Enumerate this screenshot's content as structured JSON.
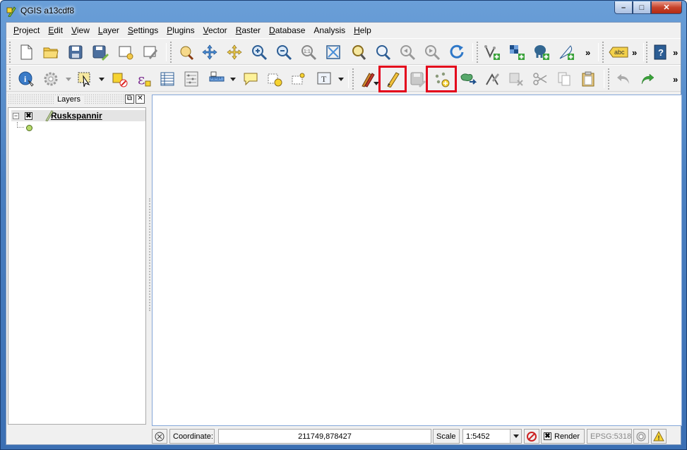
{
  "window": {
    "title": "QGIS a13cdf8",
    "controls": {
      "minimize": "–",
      "maximize": "□",
      "close": "✕"
    }
  },
  "menubar": {
    "items": [
      {
        "label": "Project",
        "mnemonic": "P",
        "rest": "roject"
      },
      {
        "label": "Edit",
        "mnemonic": "E",
        "rest": "dit"
      },
      {
        "label": "View",
        "mnemonic": "V",
        "rest": "iew"
      },
      {
        "label": "Layer",
        "mnemonic": "L",
        "rest": "ayer"
      },
      {
        "label": "Settings",
        "mnemonic": "S",
        "rest": "ettings"
      },
      {
        "label": "Plugins",
        "mnemonic": "P",
        "rest": "lugins"
      },
      {
        "label": "Vector",
        "mnemonic": "V",
        "rest": "ector"
      },
      {
        "label": "Raster",
        "mnemonic": "R",
        "rest": "aster"
      },
      {
        "label": "Database",
        "mnemonic": "D",
        "rest": "atabase"
      },
      {
        "label": "Analysis",
        "mnemonic": "",
        "rest": "Analysis"
      },
      {
        "label": "Help",
        "mnemonic": "H",
        "rest": "elp"
      }
    ]
  },
  "toolbar1": {
    "overflow": "»",
    "label_tool_text": "abc",
    "help_text": "?"
  },
  "toolbar2": {
    "overflow": "»",
    "text_annotation": "T",
    "expression_symbol": "ε"
  },
  "highlights": [
    "toggle-editing-button",
    "add-feature-button"
  ],
  "layers_panel": {
    "title": "Layers",
    "float_btn": "⧉",
    "close_btn": "✕",
    "tree": [
      {
        "name": "Ruskspannir",
        "expanded": true,
        "checked": true,
        "checkmark": "✖",
        "expander": "−",
        "symbol": "point"
      }
    ]
  },
  "statusbar": {
    "coordinate_label": "Coordinate:",
    "coordinate_value": "211749,878427",
    "scale_label": "Scale",
    "scale_value": "1:5452",
    "render_checkmark": "✖",
    "render_label": "Render",
    "crs": "EPSG:5318",
    "warning_symbol": "!"
  },
  "colors": {
    "highlight": "#e3001b",
    "titlebar": "#4a7fc0",
    "canvas_border": "#84a6d8",
    "point_symbol": "#b6d96a"
  }
}
